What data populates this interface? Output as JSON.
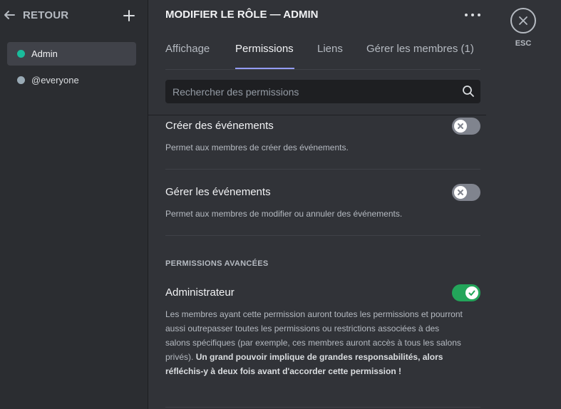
{
  "sidebar": {
    "back_label": "RETOUR",
    "roles": [
      {
        "label": "Admin",
        "color": "#1abc9c",
        "selected": true
      },
      {
        "label": "@everyone",
        "color": "#99aab5",
        "selected": false
      }
    ]
  },
  "header": {
    "title": "MODIFIER LE RÔLE — ADMIN"
  },
  "tabs": [
    {
      "label": "Affichage"
    },
    {
      "label": "Permissions",
      "selected": true
    },
    {
      "label": "Liens"
    },
    {
      "label": "Gérer les membres (1)"
    }
  ],
  "search": {
    "placeholder": "Rechercher des permissions",
    "value": ""
  },
  "permissions": [
    {
      "name": "Créer des événements",
      "description": "Permet aux membres de créer des événements.",
      "enabled": false
    },
    {
      "name": "Gérer les événements",
      "description": "Permet aux membres de modifier ou annuler des événements.",
      "enabled": false
    }
  ],
  "advanced": {
    "section_title": "PERMISSIONS AVANCÉES",
    "name": "Administrateur",
    "description": "Les membres ayant cette permission auront toutes les permissions et pourront aussi outrepasser toutes les permissions ou restrictions associées à des salons spécifiques (par exemple, ces membres auront accès à tous les salons privés).",
    "description_bold": "Un grand pouvoir implique de grandes responsabilités, alors réfléchis-y à deux fois avant d'accorder cette permission !",
    "enabled": true
  },
  "close": {
    "label": "ESC"
  },
  "colors": {
    "accent": "#949cf7",
    "toggle_on": "#23a55a",
    "toggle_off": "#80848e"
  }
}
